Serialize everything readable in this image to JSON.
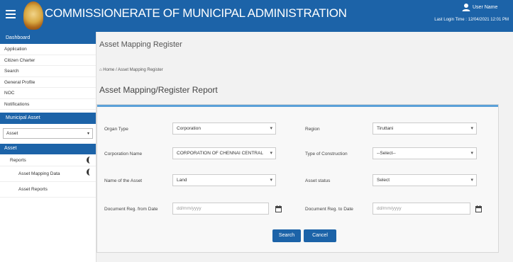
{
  "header": {
    "title": "COMMISSIONERATE OF MUNICIPAL ADMINISTRATION",
    "user_name": "User Name",
    "last_login": "Last Login Time : 12/04/2021 12:01 PM"
  },
  "sidebar": {
    "section_title": "Dashboard",
    "items": [
      "Application",
      "Citizen Charter",
      "Search",
      "General Profile",
      "NOC",
      "Notifications"
    ],
    "module_title": "Municipal Asset",
    "module_select": "Asset",
    "asset_label": "Asset",
    "reports_label": "Reports",
    "children": [
      "Asset Mapping Data",
      "Asset Reports"
    ]
  },
  "page": {
    "title": "Asset Mapping Register",
    "breadcrumb_home": "Home",
    "breadcrumb_current": "Asset Mapping Register",
    "report_title": "Asset Mapping/Register Report"
  },
  "form": {
    "left": [
      {
        "label": "Organ Type",
        "value": "Corporation",
        "kind": "select"
      },
      {
        "label": "Corporation Name",
        "value": "CORPORATION OF CHENNAI CENTRAL",
        "kind": "select"
      },
      {
        "label": "Name of the Asset",
        "value": "Land",
        "kind": "select"
      },
      {
        "label": "Document Reg. from Date",
        "placeholder": "dd/mm/yyyy",
        "kind": "date"
      }
    ],
    "right": [
      {
        "label": "Region",
        "value": "Tiruttani",
        "kind": "select"
      },
      {
        "label": "Type of Construction",
        "value": "--Select--",
        "kind": "select"
      },
      {
        "label": "Asset status",
        "value": "Select",
        "kind": "select"
      },
      {
        "label": "Document Reg. to Date",
        "placeholder": "dd/mm/yyyy",
        "kind": "date"
      }
    ],
    "search_label": "Search",
    "cancel_label": "Cancel"
  }
}
